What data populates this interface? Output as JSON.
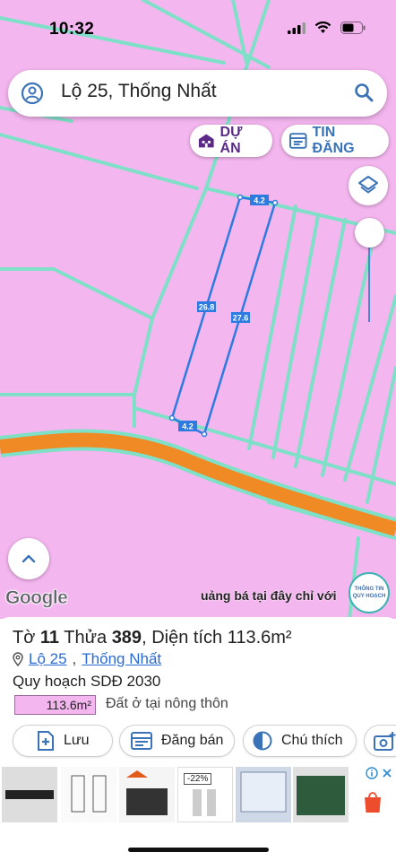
{
  "status": {
    "time": "10:32"
  },
  "search": {
    "query": "Lộ 25, Thống Nhất"
  },
  "chips": {
    "project": "DỰ ÁN",
    "listing": "TIN ĐĂNG"
  },
  "map": {
    "dim_top": "4.2",
    "dim_bottom": "4.2",
    "dim_left": "26.8",
    "dim_right": "27.6",
    "google": "Google",
    "ad_ticker": "uảng bá tại đây chỉ với",
    "info_badge_line1": "THÔNG TIN",
    "info_badge_line2": "QUY HOẠCH"
  },
  "parcel": {
    "sheet_label": "Tờ",
    "sheet": "11",
    "lot_label": "Thửa",
    "lot": "389",
    "area_label": "Diện tích",
    "area": "113.6m²",
    "address_street": "Lộ 25",
    "address_commune": "Thống Nhất",
    "plan_title": "Quy hoạch SDĐ 2030",
    "area_badge": "113.6m²",
    "land_type": "Đất ở tại nông thôn"
  },
  "actions": {
    "save": "Lưu",
    "sell": "Đăng bán",
    "legend": "Chú thích"
  },
  "ads": {
    "thumb_discount": "-22%"
  },
  "colors": {
    "map_pink": "#f4b6ef",
    "road": "#f08a24",
    "boundary": "#7fe0c8",
    "parcel_outline": "#2d7be0",
    "accent_purple": "#5b2a86",
    "accent_blue": "#3a73b8"
  }
}
